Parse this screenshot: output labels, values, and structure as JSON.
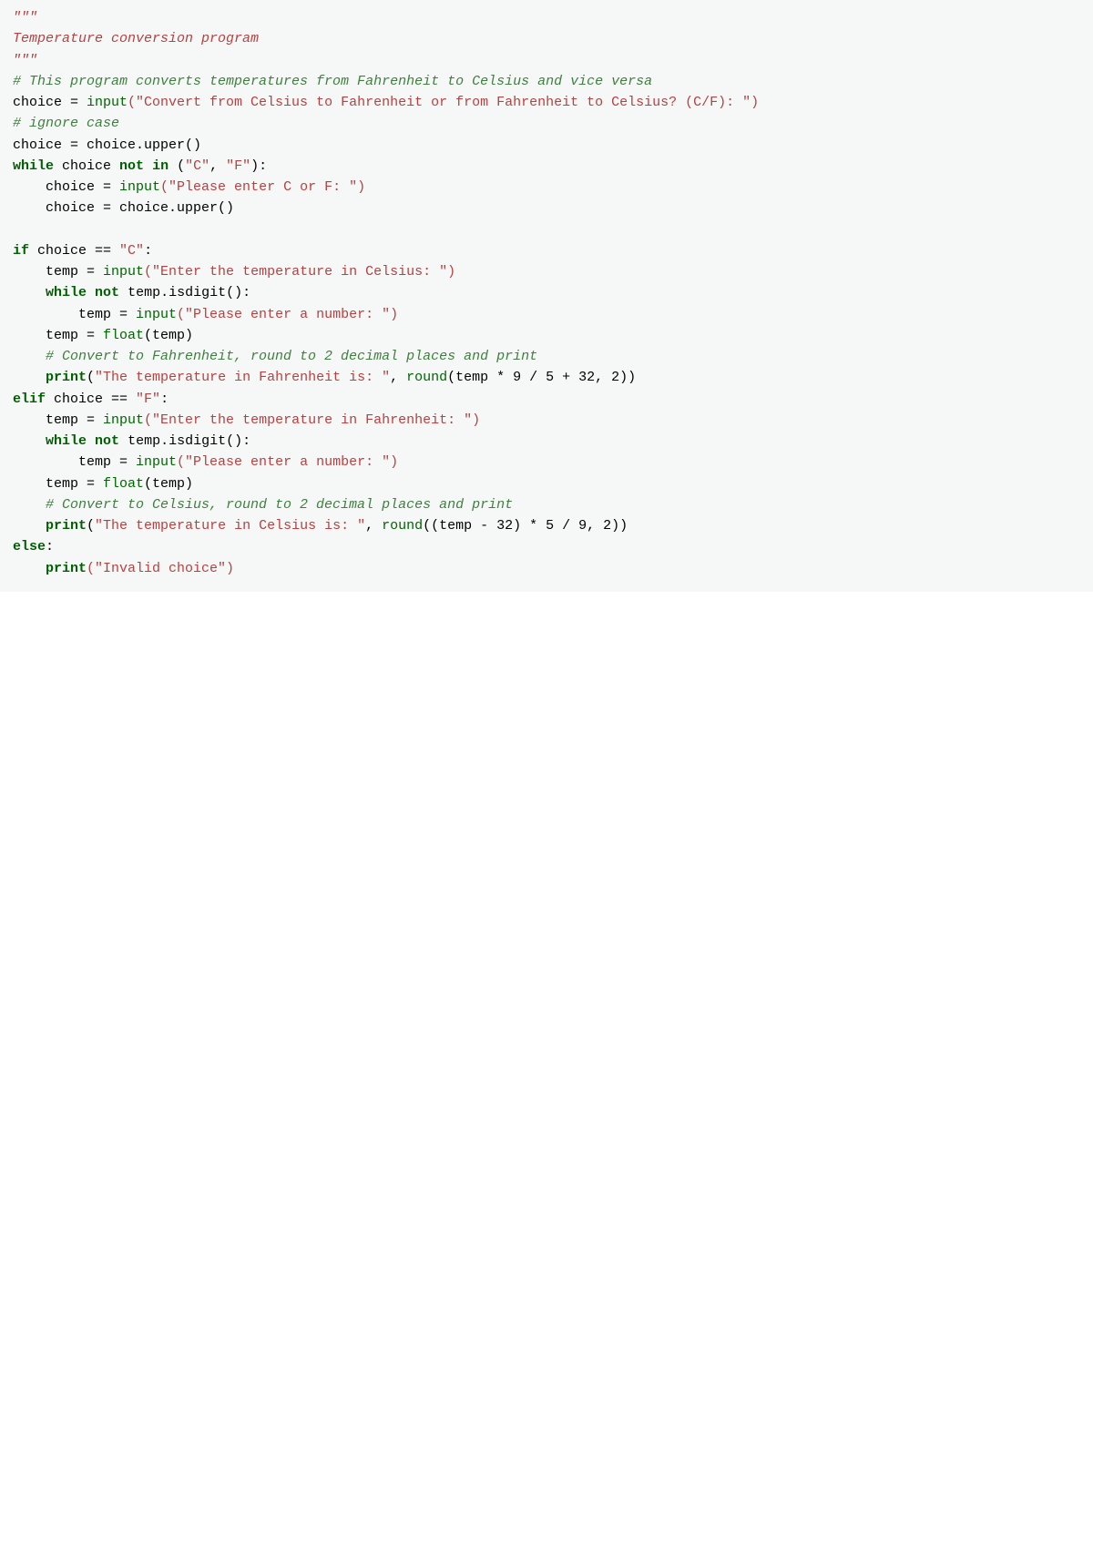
{
  "code": {
    "docstring_open": "\"\"\"",
    "docstring_text": "Temperature conversion program",
    "docstring_close": "\"\"\"",
    "comment_intro": "# This program converts temperatures from Fahrenheit to Celsius and vice versa",
    "line_choice_assign_prefix": "choice = ",
    "input_fn": "input",
    "prompt_main": "(\"Convert from Celsius to Fahrenheit or from Fahrenheit to Celsius? (C/F): \")",
    "comment_ignore_case": "# ignore case",
    "line_choice_upper": "choice = choice.upper()",
    "kw_while": "while",
    "while_cond_notin": " choice ",
    "kw_not": "not",
    "kw_in": "in",
    "tuple_open": " (",
    "str_C": "\"C\"",
    "comma": ", ",
    "str_F": "\"F\"",
    "tuple_close": "):",
    "line_choice_reassign_prefix": "    choice = ",
    "prompt_cf": "(\"Please enter C or F: \")",
    "line_choice_upper_indented": "    choice = choice.upper()",
    "blank": "",
    "kw_if": "if",
    "if_cond_c": " choice == ",
    "colon": ":",
    "line_temp_assign_prefix": "    temp = ",
    "prompt_celsius": "(\"Enter the temperature in Celsius: \")",
    "while_indent": "    ",
    "while_not_digit": " temp.isdigit():",
    "line_temp_reassign_prefix": "        temp = ",
    "prompt_number": "(\"Please enter a number: \")",
    "line_temp_float": "    temp = ",
    "float_fn": "float",
    "float_arg": "(temp)",
    "comment_convert_f": "    # Convert to Fahrenheit, round to 2 decimal places and print",
    "print_indent": "    ",
    "print_fn": "print",
    "print_f_args_open": "(",
    "str_temp_f": "\"The temperature in Fahrenheit is: \"",
    "print_f_rest": ", ",
    "round_fn": "round",
    "round_f_args": "(temp * 9 / 5 + 32, 2))",
    "kw_elif": "elif",
    "elif_cond_f": " choice == ",
    "prompt_fahrenheit": "(\"Enter the temperature in Fahrenheit: \")",
    "comment_convert_c": "    # Convert to Celsius, round to 2 decimal places and print",
    "str_temp_c": "\"The temperature in Celsius is: \"",
    "round_c_args": "((temp - 32) * 5 / 9, 2))",
    "kw_else": "else",
    "else_colon": ":",
    "str_invalid": "(\"Invalid choice\")"
  }
}
